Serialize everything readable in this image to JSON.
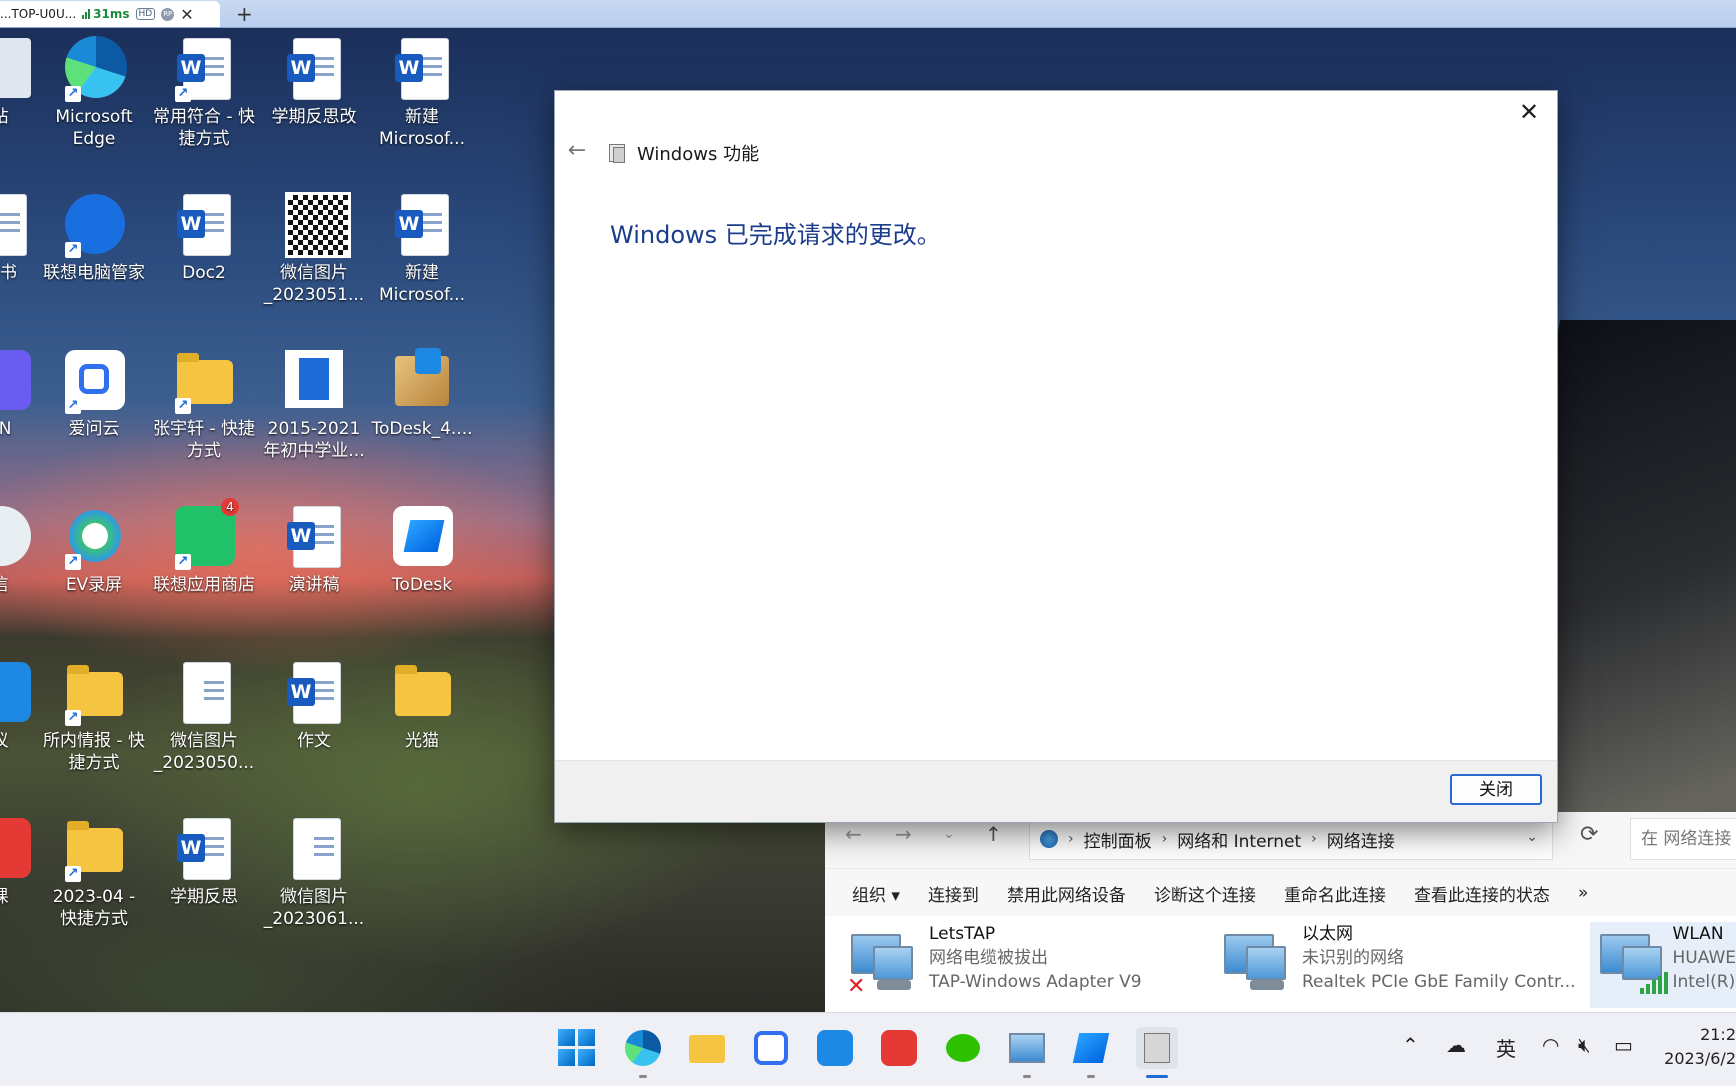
{
  "remote_tab": {
    "name": "...TOP-U0U...",
    "ping": "31ms",
    "hd": "HD",
    "rp": "RP"
  },
  "desktop_icons": [
    {
      "label": "站"
    },
    {
      "label": "Microsoft Edge"
    },
    {
      "label": "常用符合 - 快捷方式"
    },
    {
      "label": "学期反思改"
    },
    {
      "label": "新建 Microsof..."
    },
    {
      "label": "请书"
    },
    {
      "label": "联想电脑管家"
    },
    {
      "label": "Doc2"
    },
    {
      "label": "微信图片_2023051..."
    },
    {
      "label": "新建 Microsof..."
    },
    {
      "label": "PN"
    },
    {
      "label": "爱问云"
    },
    {
      "label": "张宇轩 - 快捷方式"
    },
    {
      "label": "2015-2021年初中学业..."
    },
    {
      "label": "ToDesk_4...."
    },
    {
      "label": "信"
    },
    {
      "label": "EV录屏"
    },
    {
      "label": "联想应用商店"
    },
    {
      "label": "演讲稿"
    },
    {
      "label": "ToDesk"
    },
    {
      "label": "议"
    },
    {
      "label": "所内情报 - 快捷方式"
    },
    {
      "label": "微信图片_2023050..."
    },
    {
      "label": "作文"
    },
    {
      "label": "光猫"
    },
    {
      "label": "课"
    },
    {
      "label": "2023-04 - 快捷方式"
    },
    {
      "label": "学期反思"
    },
    {
      "label": "微信图片_2023061..."
    }
  ],
  "badge_count": "4",
  "dialog": {
    "title": "Windows 功能",
    "message": "Windows 已完成请求的更改。",
    "close_button": "关闭",
    "close_x": "✕",
    "back": "←"
  },
  "explorer": {
    "breadcrumb": [
      "控制面板",
      "网络和 Internet",
      "网络连接"
    ],
    "search_placeholder": "在 网络连接",
    "commands": [
      "组织 ▾",
      "连接到",
      "禁用此网络设备",
      "诊断这个连接",
      "重命名此连接",
      "查看此连接的状态",
      "»"
    ],
    "connections": [
      {
        "name": "LetsTAP",
        "status": "网络电缆被拔出",
        "adapter": "TAP-Windows Adapter V9"
      },
      {
        "name": "以太网",
        "status": "未识别的网络",
        "adapter": "Realtek PCIe GbE Family Contr..."
      },
      {
        "name": "WLAN",
        "status": "HUAWE",
        "adapter": "Intel(R)"
      }
    ]
  },
  "taskbar": {
    "ime": "英",
    "time": "21:2",
    "date": "2023/6/2"
  },
  "accent_color": "#1e6ad6"
}
